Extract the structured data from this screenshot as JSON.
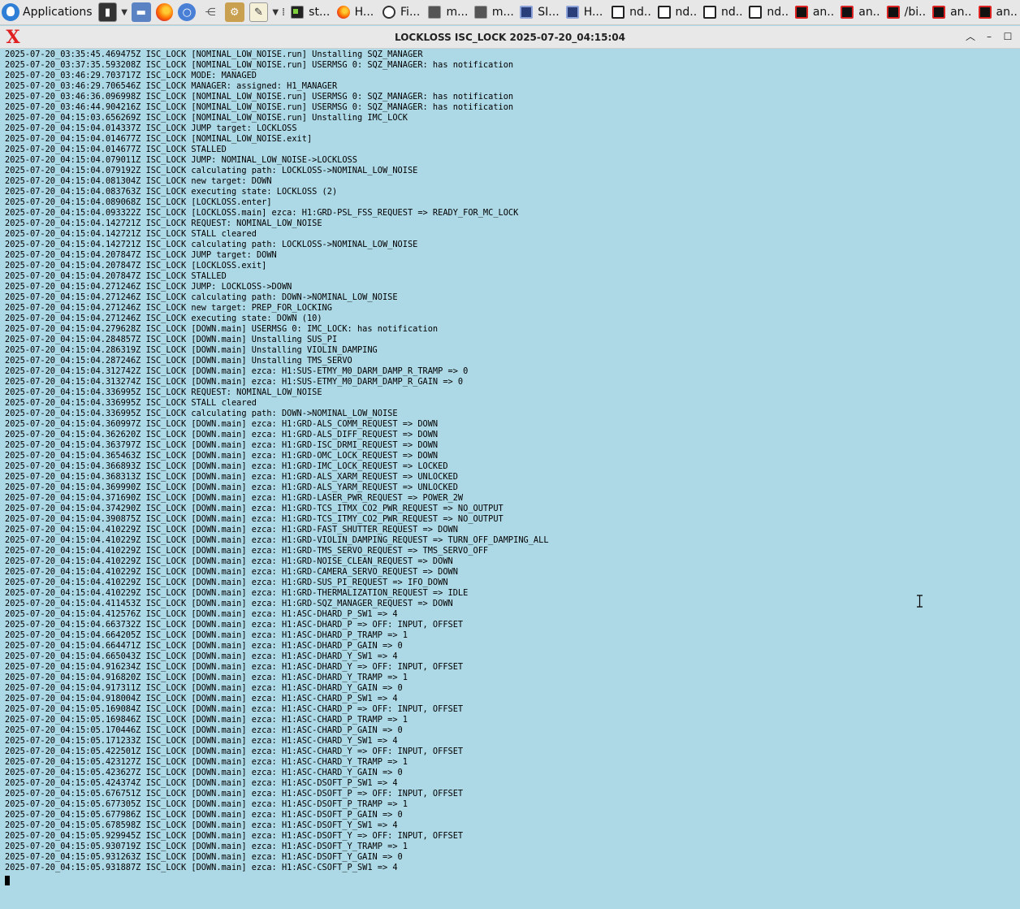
{
  "taskbar": {
    "apps_label": "Applications",
    "tasks": [
      {
        "label": "st...",
        "icon": "terminal-icon"
      },
      {
        "label": "H...",
        "icon": "firefox-icon"
      },
      {
        "label": "Fi...",
        "icon": "clock-icon"
      },
      {
        "label": "m...",
        "icon": "window-icon"
      },
      {
        "label": "m...",
        "icon": "window-icon"
      },
      {
        "label": "SI...",
        "icon": "monitor-icon"
      },
      {
        "label": "H...",
        "icon": "monitor-icon"
      },
      {
        "label": "nd...",
        "icon": "document-icon"
      },
      {
        "label": "nd...",
        "icon": "document-icon"
      },
      {
        "label": "nd...",
        "icon": "document-icon"
      },
      {
        "label": "nd...",
        "icon": "document-icon"
      },
      {
        "label": "an...",
        "icon": "red-terminal-icon"
      },
      {
        "label": "an...",
        "icon": "red-terminal-icon"
      },
      {
        "label": "/bi...",
        "icon": "red-terminal-icon"
      },
      {
        "label": "an...",
        "icon": "red-terminal-icon"
      },
      {
        "label": "an...",
        "icon": "red-terminal-icon"
      }
    ]
  },
  "window": {
    "title": "LOCKLOSS ISC_LOCK 2025-07-20_04:15:04"
  },
  "log_lines": [
    "2025-07-20_03:35:45.469475Z ISC_LOCK [NOMINAL_LOW_NOISE.run] Unstalling SQZ_MANAGER",
    "2025-07-20_03:37:35.593208Z ISC_LOCK [NOMINAL_LOW_NOISE.run] USERMSG 0: SQZ_MANAGER: has notification",
    "2025-07-20_03:46:29.703717Z ISC_LOCK MODE: MANAGED",
    "2025-07-20_03:46:29.706546Z ISC_LOCK MANAGER: assigned: H1_MANAGER",
    "2025-07-20_03:46:36.096998Z ISC_LOCK [NOMINAL_LOW_NOISE.run] USERMSG 0: SQZ_MANAGER: has notification",
    "2025-07-20_03:46:44.904216Z ISC_LOCK [NOMINAL_LOW_NOISE.run] USERMSG 0: SQZ_MANAGER: has notification",
    "2025-07-20_04:15:03.656269Z ISC_LOCK [NOMINAL_LOW_NOISE.run] Unstalling IMC_LOCK",
    "2025-07-20_04:15:04.014337Z ISC_LOCK JUMP target: LOCKLOSS",
    "2025-07-20_04:15:04.014677Z ISC_LOCK [NOMINAL_LOW_NOISE.exit]",
    "2025-07-20_04:15:04.014677Z ISC_LOCK STALLED",
    "2025-07-20_04:15:04.079011Z ISC_LOCK JUMP: NOMINAL_LOW_NOISE->LOCKLOSS",
    "2025-07-20_04:15:04.079192Z ISC_LOCK calculating path: LOCKLOSS->NOMINAL_LOW_NOISE",
    "2025-07-20_04:15:04.081304Z ISC_LOCK new target: DOWN",
    "2025-07-20_04:15:04.083763Z ISC_LOCK executing state: LOCKLOSS (2)",
    "2025-07-20_04:15:04.089068Z ISC_LOCK [LOCKLOSS.enter]",
    "2025-07-20_04:15:04.093322Z ISC_LOCK [LOCKLOSS.main] ezca: H1:GRD-PSL_FSS_REQUEST => READY_FOR_MC_LOCK",
    "2025-07-20_04:15:04.142721Z ISC_LOCK REQUEST: NOMINAL_LOW_NOISE",
    "2025-07-20_04:15:04.142721Z ISC_LOCK STALL cleared",
    "2025-07-20_04:15:04.142721Z ISC_LOCK calculating path: LOCKLOSS->NOMINAL_LOW_NOISE",
    "2025-07-20_04:15:04.207847Z ISC_LOCK JUMP target: DOWN",
    "2025-07-20_04:15:04.207847Z ISC_LOCK [LOCKLOSS.exit]",
    "2025-07-20_04:15:04.207847Z ISC_LOCK STALLED",
    "2025-07-20_04:15:04.271246Z ISC_LOCK JUMP: LOCKLOSS->DOWN",
    "2025-07-20_04:15:04.271246Z ISC_LOCK calculating path: DOWN->NOMINAL_LOW_NOISE",
    "2025-07-20_04:15:04.271246Z ISC_LOCK new target: PREP_FOR_LOCKING",
    "2025-07-20_04:15:04.271246Z ISC_LOCK executing state: DOWN (10)",
    "2025-07-20_04:15:04.279628Z ISC_LOCK [DOWN.main] USERMSG 0: IMC_LOCK: has notification",
    "2025-07-20_04:15:04.284857Z ISC_LOCK [DOWN.main] Unstalling SUS_PI",
    "2025-07-20_04:15:04.286319Z ISC_LOCK [DOWN.main] Unstalling VIOLIN_DAMPING",
    "2025-07-20_04:15:04.287246Z ISC_LOCK [DOWN.main] Unstalling TMS_SERVO",
    "2025-07-20_04:15:04.312742Z ISC_LOCK [DOWN.main] ezca: H1:SUS-ETMY_M0_DARM_DAMP_R_TRAMP => 0",
    "2025-07-20_04:15:04.313274Z ISC_LOCK [DOWN.main] ezca: H1:SUS-ETMY_M0_DARM_DAMP_R_GAIN => 0",
    "2025-07-20_04:15:04.336995Z ISC_LOCK REQUEST: NOMINAL_LOW_NOISE",
    "2025-07-20_04:15:04.336995Z ISC_LOCK STALL cleared",
    "2025-07-20_04:15:04.336995Z ISC_LOCK calculating path: DOWN->NOMINAL_LOW_NOISE",
    "2025-07-20_04:15:04.360997Z ISC_LOCK [DOWN.main] ezca: H1:GRD-ALS_COMM_REQUEST => DOWN",
    "2025-07-20_04:15:04.362620Z ISC_LOCK [DOWN.main] ezca: H1:GRD-ALS_DIFF_REQUEST => DOWN",
    "2025-07-20_04:15:04.363797Z ISC_LOCK [DOWN.main] ezca: H1:GRD-ISC_DRMI_REQUEST => DOWN",
    "2025-07-20_04:15:04.365463Z ISC_LOCK [DOWN.main] ezca: H1:GRD-OMC_LOCK_REQUEST => DOWN",
    "2025-07-20_04:15:04.366893Z ISC_LOCK [DOWN.main] ezca: H1:GRD-IMC_LOCK_REQUEST => LOCKED",
    "2025-07-20_04:15:04.368313Z ISC_LOCK [DOWN.main] ezca: H1:GRD-ALS_XARM_REQUEST => UNLOCKED",
    "2025-07-20_04:15:04.369990Z ISC_LOCK [DOWN.main] ezca: H1:GRD-ALS_YARM_REQUEST => UNLOCKED",
    "2025-07-20_04:15:04.371690Z ISC_LOCK [DOWN.main] ezca: H1:GRD-LASER_PWR_REQUEST => POWER_2W",
    "2025-07-20_04:15:04.374290Z ISC_LOCK [DOWN.main] ezca: H1:GRD-TCS_ITMX_CO2_PWR_REQUEST => NO_OUTPUT",
    "2025-07-20_04:15:04.390875Z ISC_LOCK [DOWN.main] ezca: H1:GRD-TCS_ITMY_CO2_PWR_REQUEST => NO_OUTPUT",
    "2025-07-20_04:15:04.410229Z ISC_LOCK [DOWN.main] ezca: H1:GRD-FAST_SHUTTER_REQUEST => DOWN",
    "2025-07-20_04:15:04.410229Z ISC_LOCK [DOWN.main] ezca: H1:GRD-VIOLIN_DAMPING_REQUEST => TURN_OFF_DAMPING_ALL",
    "2025-07-20_04:15:04.410229Z ISC_LOCK [DOWN.main] ezca: H1:GRD-TMS_SERVO_REQUEST => TMS_SERVO_OFF",
    "2025-07-20_04:15:04.410229Z ISC_LOCK [DOWN.main] ezca: H1:GRD-NOISE_CLEAN_REQUEST => DOWN",
    "2025-07-20_04:15:04.410229Z ISC_LOCK [DOWN.main] ezca: H1:GRD-CAMERA_SERVO_REQUEST => DOWN",
    "2025-07-20_04:15:04.410229Z ISC_LOCK [DOWN.main] ezca: H1:GRD-SUS_PI_REQUEST => IFO_DOWN",
    "2025-07-20_04:15:04.410229Z ISC_LOCK [DOWN.main] ezca: H1:GRD-THERMALIZATION_REQUEST => IDLE",
    "2025-07-20_04:15:04.411453Z ISC_LOCK [DOWN.main] ezca: H1:GRD-SQZ_MANAGER_REQUEST => DOWN",
    "2025-07-20_04:15:04.412576Z ISC_LOCK [DOWN.main] ezca: H1:ASC-DHARD_P_SW1 => 4",
    "2025-07-20_04:15:04.663732Z ISC_LOCK [DOWN.main] ezca: H1:ASC-DHARD_P => OFF: INPUT, OFFSET",
    "2025-07-20_04:15:04.664205Z ISC_LOCK [DOWN.main] ezca: H1:ASC-DHARD_P_TRAMP => 1",
    "2025-07-20_04:15:04.664471Z ISC_LOCK [DOWN.main] ezca: H1:ASC-DHARD_P_GAIN => 0",
    "2025-07-20_04:15:04.665043Z ISC_LOCK [DOWN.main] ezca: H1:ASC-DHARD_Y_SW1 => 4",
    "2025-07-20_04:15:04.916234Z ISC_LOCK [DOWN.main] ezca: H1:ASC-DHARD_Y => OFF: INPUT, OFFSET",
    "2025-07-20_04:15:04.916820Z ISC_LOCK [DOWN.main] ezca: H1:ASC-DHARD_Y_TRAMP => 1",
    "2025-07-20_04:15:04.917311Z ISC_LOCK [DOWN.main] ezca: H1:ASC-DHARD_Y_GAIN => 0",
    "2025-07-20_04:15:04.918004Z ISC_LOCK [DOWN.main] ezca: H1:ASC-CHARD_P_SW1 => 4",
    "2025-07-20_04:15:05.169084Z ISC_LOCK [DOWN.main] ezca: H1:ASC-CHARD_P => OFF: INPUT, OFFSET",
    "2025-07-20_04:15:05.169846Z ISC_LOCK [DOWN.main] ezca: H1:ASC-CHARD_P_TRAMP => 1",
    "2025-07-20_04:15:05.170446Z ISC_LOCK [DOWN.main] ezca: H1:ASC-CHARD_P_GAIN => 0",
    "2025-07-20_04:15:05.171233Z ISC_LOCK [DOWN.main] ezca: H1:ASC-CHARD_Y_SW1 => 4",
    "2025-07-20_04:15:05.422501Z ISC_LOCK [DOWN.main] ezca: H1:ASC-CHARD_Y => OFF: INPUT, OFFSET",
    "2025-07-20_04:15:05.423127Z ISC_LOCK [DOWN.main] ezca: H1:ASC-CHARD_Y_TRAMP => 1",
    "2025-07-20_04:15:05.423627Z ISC_LOCK [DOWN.main] ezca: H1:ASC-CHARD_Y_GAIN => 0",
    "2025-07-20_04:15:05.424374Z ISC_LOCK [DOWN.main] ezca: H1:ASC-DSOFT_P_SW1 => 4",
    "2025-07-20_04:15:05.676751Z ISC_LOCK [DOWN.main] ezca: H1:ASC-DSOFT_P => OFF: INPUT, OFFSET",
    "2025-07-20_04:15:05.677305Z ISC_LOCK [DOWN.main] ezca: H1:ASC-DSOFT_P_TRAMP => 1",
    "2025-07-20_04:15:05.677986Z ISC_LOCK [DOWN.main] ezca: H1:ASC-DSOFT_P_GAIN => 0",
    "2025-07-20_04:15:05.678598Z ISC_LOCK [DOWN.main] ezca: H1:ASC-DSOFT_Y_SW1 => 4",
    "2025-07-20_04:15:05.929945Z ISC_LOCK [DOWN.main] ezca: H1:ASC-DSOFT_Y => OFF: INPUT, OFFSET",
    "2025-07-20_04:15:05.930719Z ISC_LOCK [DOWN.main] ezca: H1:ASC-DSOFT_Y_TRAMP => 1",
    "2025-07-20_04:15:05.931263Z ISC_LOCK [DOWN.main] ezca: H1:ASC-DSOFT_Y_GAIN => 0",
    "2025-07-20_04:15:05.931887Z ISC_LOCK [DOWN.main] ezca: H1:ASC-CSOFT_P_SW1 => 4"
  ]
}
